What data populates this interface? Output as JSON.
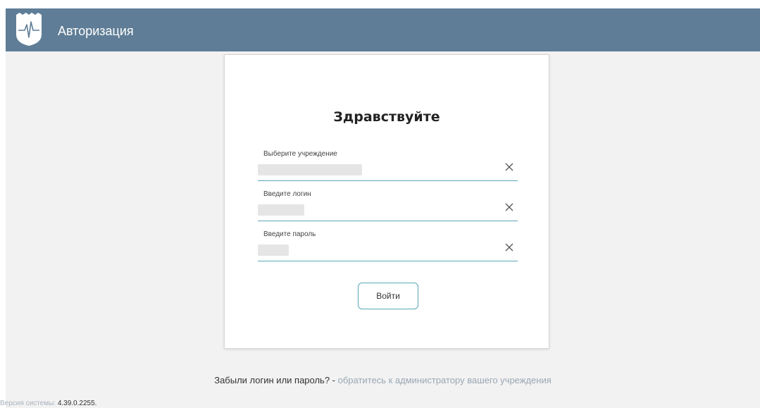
{
  "header": {
    "title": "Авторизация",
    "logo_icon": "city-emblem-heartbeat-icon",
    "background": "#5f7d96"
  },
  "card": {
    "greeting": "Здравствуйте",
    "fields": [
      {
        "label": "Выберите учреждение",
        "value": "",
        "clear_icon": "close-icon"
      },
      {
        "label": "Введите логин",
        "value": "",
        "clear_icon": "close-icon"
      },
      {
        "label": "Введите пароль",
        "value": "",
        "clear_icon": "close-icon"
      }
    ],
    "login_button": "Войти",
    "accent_color": "#5aa7b7"
  },
  "footer": {
    "forgot_question": "Забыли логин или пароль?",
    "separator": " - ",
    "forgot_link": "обратитесь к администратору вашего учреждения",
    "version_label": "Версия системы: ",
    "version_number": "4.39.0.2255."
  }
}
